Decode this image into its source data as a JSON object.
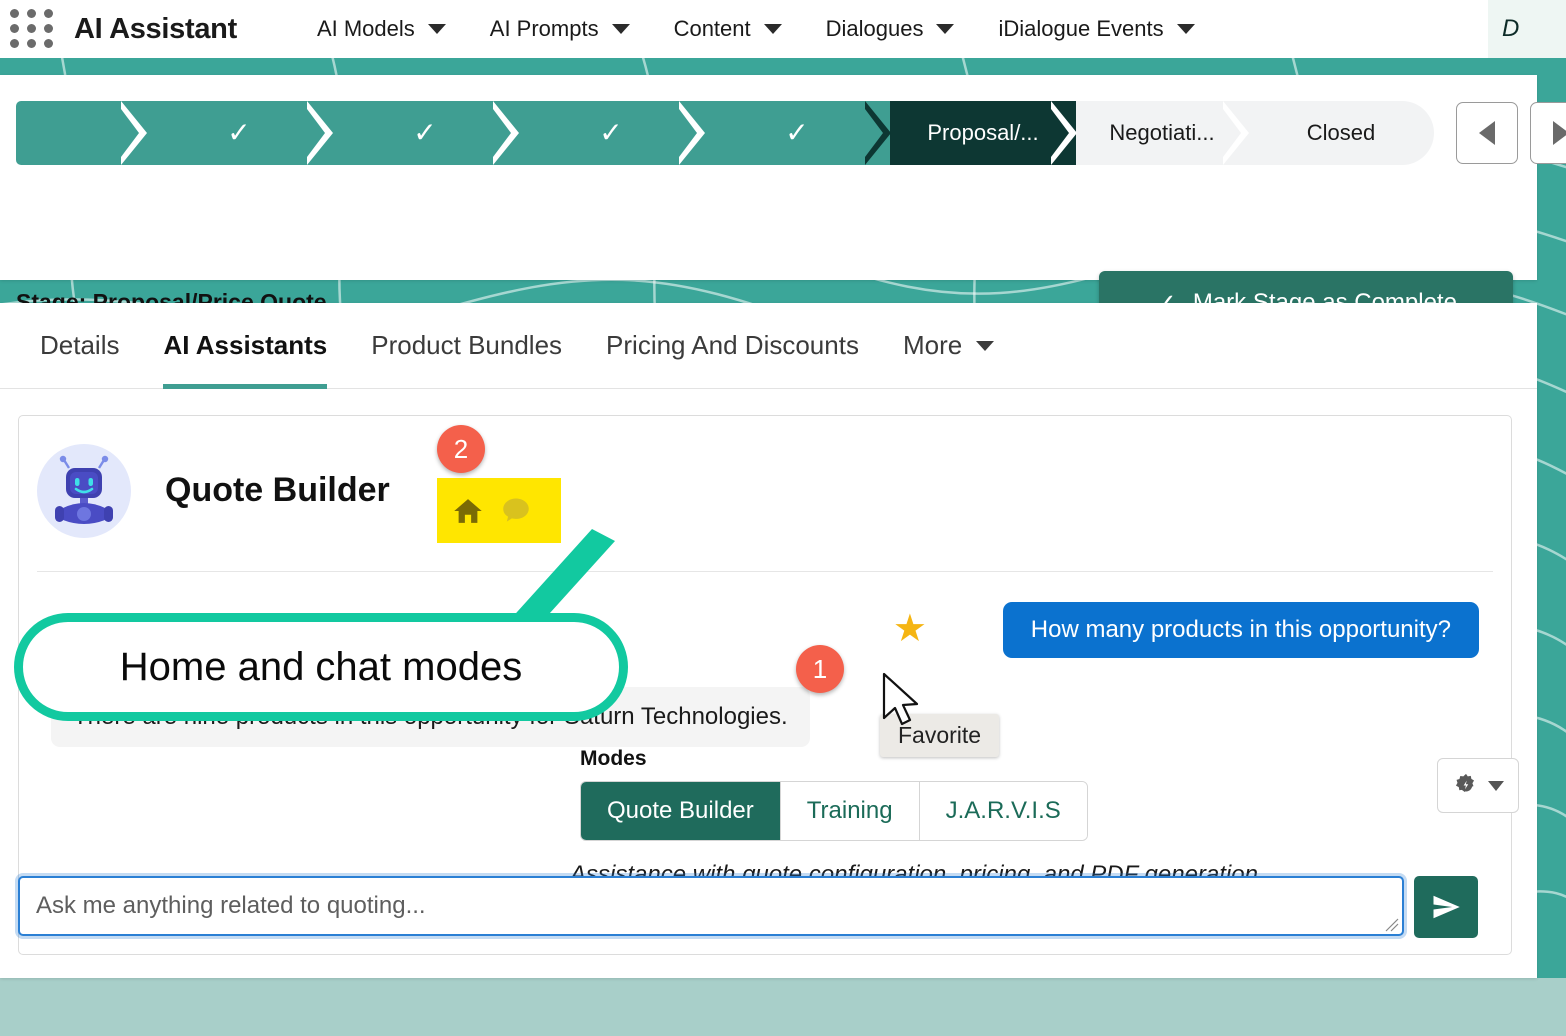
{
  "topnav": {
    "grid_icon": "apps-grid-icon",
    "app_title": "AI Assistant",
    "items": [
      {
        "label": "AI Models",
        "icon": "chevron-down-icon"
      },
      {
        "label": "AI Prompts",
        "icon": "chevron-down-icon"
      },
      {
        "label": "Content",
        "icon": "chevron-down-icon"
      },
      {
        "label": "Dialogues",
        "icon": "chevron-down-icon"
      },
      {
        "label": "iDialogue Events",
        "icon": "chevron-down-icon"
      }
    ],
    "tail_star": "*",
    "tail_text": "D"
  },
  "stage_path": {
    "segments": [
      {
        "label": "",
        "state": "done",
        "icon": "check-icon"
      },
      {
        "label": "",
        "state": "done",
        "icon": "check-icon"
      },
      {
        "label": "",
        "state": "done",
        "icon": "check-icon"
      },
      {
        "label": "",
        "state": "done",
        "icon": "check-icon"
      },
      {
        "label": "",
        "state": "done",
        "icon": "check-icon"
      },
      {
        "label": "Proposal/...",
        "state": "current",
        "icon": ""
      },
      {
        "label": "Negotiati...",
        "state": "todo",
        "icon": ""
      },
      {
        "label": "Closed",
        "state": "todo",
        "icon": ""
      }
    ],
    "prev_icon": "triangle-left-icon",
    "next_icon": "triangle-right-icon",
    "stage_label": "Stage: Proposal/Price Quote",
    "mark_complete_label": "Mark Stage as Complete",
    "mark_complete_icon": "check-icon"
  },
  "tabs": {
    "items": [
      {
        "label": "Details",
        "active": false
      },
      {
        "label": "AI Assistants",
        "active": true
      },
      {
        "label": "Product Bundles",
        "active": false
      },
      {
        "label": "Pricing And Discounts",
        "active": false
      }
    ],
    "more_label": "More",
    "more_icon": "chevron-down-icon"
  },
  "assistant": {
    "avatar_icon": "robot-avatar-icon",
    "name": "Quote Builder",
    "home_icon": "home-icon",
    "chat_icon": "chat-bubble-icon",
    "modes_label": "Modes",
    "modes": [
      {
        "label": "Quote Builder",
        "selected": true
      },
      {
        "label": "Training",
        "selected": false
      },
      {
        "label": "J.A.R.V.I.S",
        "selected": false
      }
    ],
    "description": "Assistance with quote configuration, pricing, and PDF generation.",
    "settings_icon": "gear-bolt-icon",
    "settings_caret_icon": "caret-down-icon",
    "suggested_question": "How many products in this opportunity?",
    "favorite_icon": "star-icon",
    "tooltip": "Favorite",
    "answer": "There are nine products in this opportunity for Saturn Technologies.",
    "input_placeholder": "Ask me anything related to quoting...",
    "input_value": "",
    "send_icon": "send-arrow-icon"
  },
  "annotations": {
    "badge_1": "1",
    "badge_2": "2",
    "callout_text": "Home and chat modes",
    "callout_color": "#12c9a0",
    "highlight_color": "#ffe600",
    "badge_color": "#f4604b"
  },
  "colors": {
    "teal": "#3ba699",
    "dark_teal": "#0d3733",
    "brand_green": "#2a7465",
    "accent_blue": "#0b72cf",
    "star_gold": "#f5b513",
    "bottom_strip": "#a8cfc9"
  }
}
